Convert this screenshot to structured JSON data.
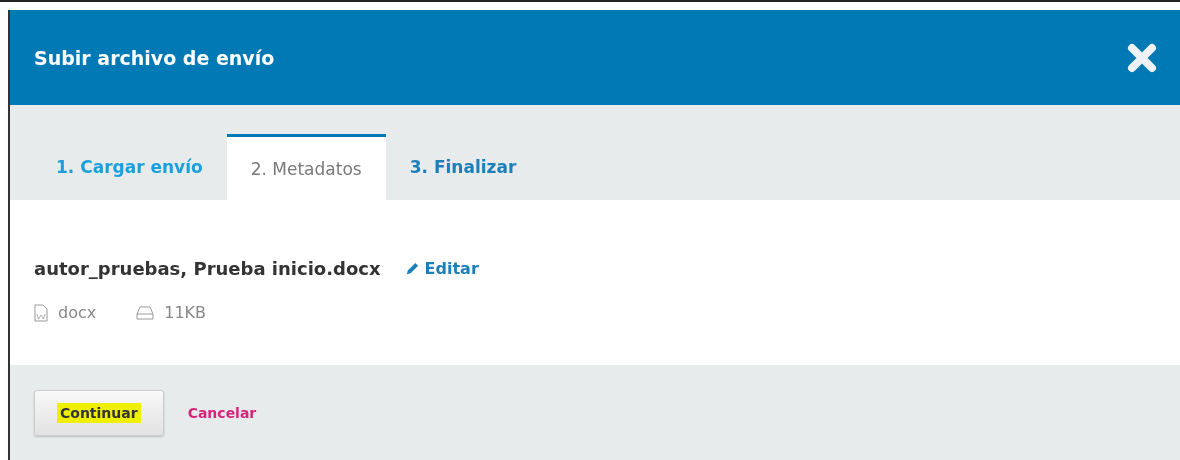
{
  "modal": {
    "title": "Subir archivo de envío"
  },
  "tabs": [
    {
      "label": "1. Cargar envío",
      "selected": false,
      "color": "#1aa0dc"
    },
    {
      "label": "2. Metadatos",
      "selected": true,
      "color": "#7a7a7a"
    },
    {
      "label": "3. Finalizar",
      "selected": false,
      "color": "#1b7fb9"
    }
  ],
  "file": {
    "name": "autor_pruebas, Prueba inicio.docx",
    "edit_link": "Editar",
    "type": "docx",
    "size": "11KB"
  },
  "buttons": {
    "primary": {
      "label": "Continuar",
      "highlighted": true
    },
    "cancel": "Cancelar"
  }
}
